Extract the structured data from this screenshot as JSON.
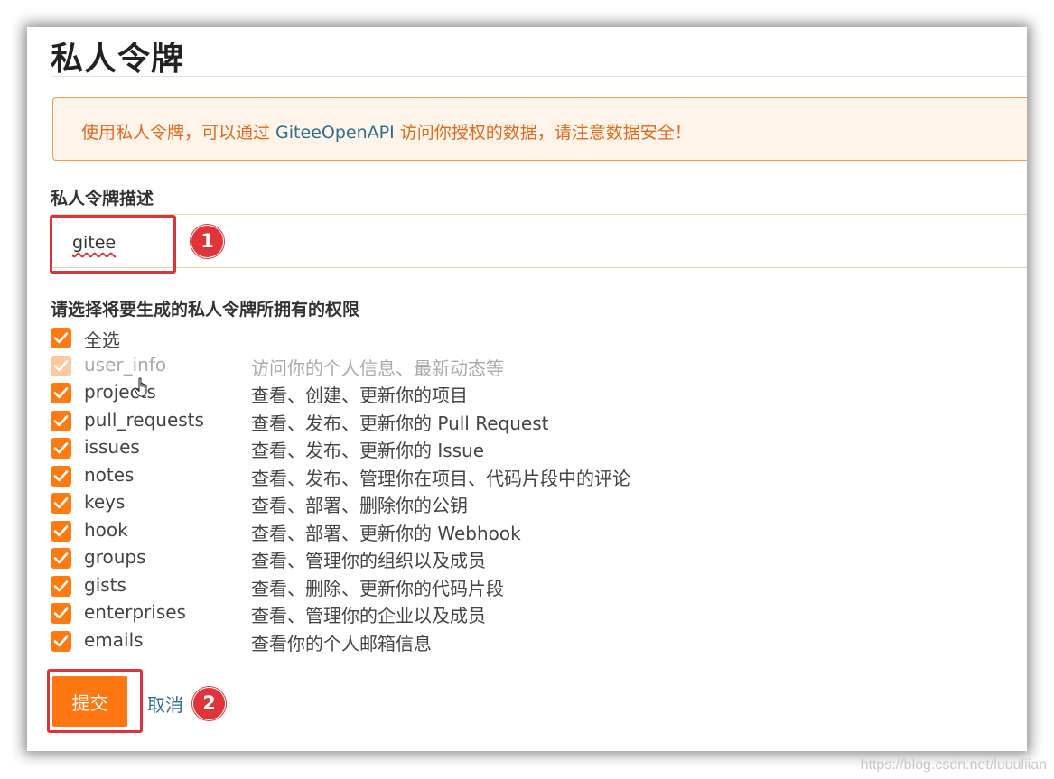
{
  "page": {
    "title": "私人令牌",
    "notice_before": "使用私人令牌，可以通过 ",
    "notice_api": "GiteeOpenAPI",
    "notice_after": " 访问你授权的数据，请注意数据安全！"
  },
  "form": {
    "desc_label": "私人令牌描述",
    "desc_value": "gitee",
    "perm_label": "请选择将要生成的私人令牌所拥有的权限",
    "select_all_label": "全选"
  },
  "permissions": [
    {
      "name": "user_info",
      "desc": "访问你的个人信息、最新动态等",
      "checked": true,
      "disabled": true
    },
    {
      "name": "projects",
      "desc": "查看、创建、更新你的项目",
      "checked": true,
      "disabled": false
    },
    {
      "name": "pull_requests",
      "desc": "查看、发布、更新你的 Pull Request",
      "checked": true,
      "disabled": false
    },
    {
      "name": "issues",
      "desc": "查看、发布、更新你的 Issue",
      "checked": true,
      "disabled": false
    },
    {
      "name": "notes",
      "desc": "查看、发布、管理你在项目、代码片段中的评论",
      "checked": true,
      "disabled": false
    },
    {
      "name": "keys",
      "desc": "查看、部署、删除你的公钥",
      "checked": true,
      "disabled": false
    },
    {
      "name": "hook",
      "desc": "查看、部署、更新你的 Webhook",
      "checked": true,
      "disabled": false
    },
    {
      "name": "groups",
      "desc": "查看、管理你的组织以及成员",
      "checked": true,
      "disabled": false
    },
    {
      "name": "gists",
      "desc": "查看、删除、更新你的代码片段",
      "checked": true,
      "disabled": false
    },
    {
      "name": "enterprises",
      "desc": "查看、管理你的企业以及成员",
      "checked": true,
      "disabled": false
    },
    {
      "name": "emails",
      "desc": "查看你的个人邮箱信息",
      "checked": true,
      "disabled": false
    }
  ],
  "actions": {
    "submit_label": "提交",
    "cancel_label": "取消"
  },
  "annotations": {
    "step1": "1",
    "step2": "2"
  },
  "watermark": "https://blog.csdn.net/luuuliian",
  "colors": {
    "accent": "#ff7710",
    "highlight": "#d9343c",
    "link": "#2d6e8e",
    "notice_text": "#e0691d"
  }
}
